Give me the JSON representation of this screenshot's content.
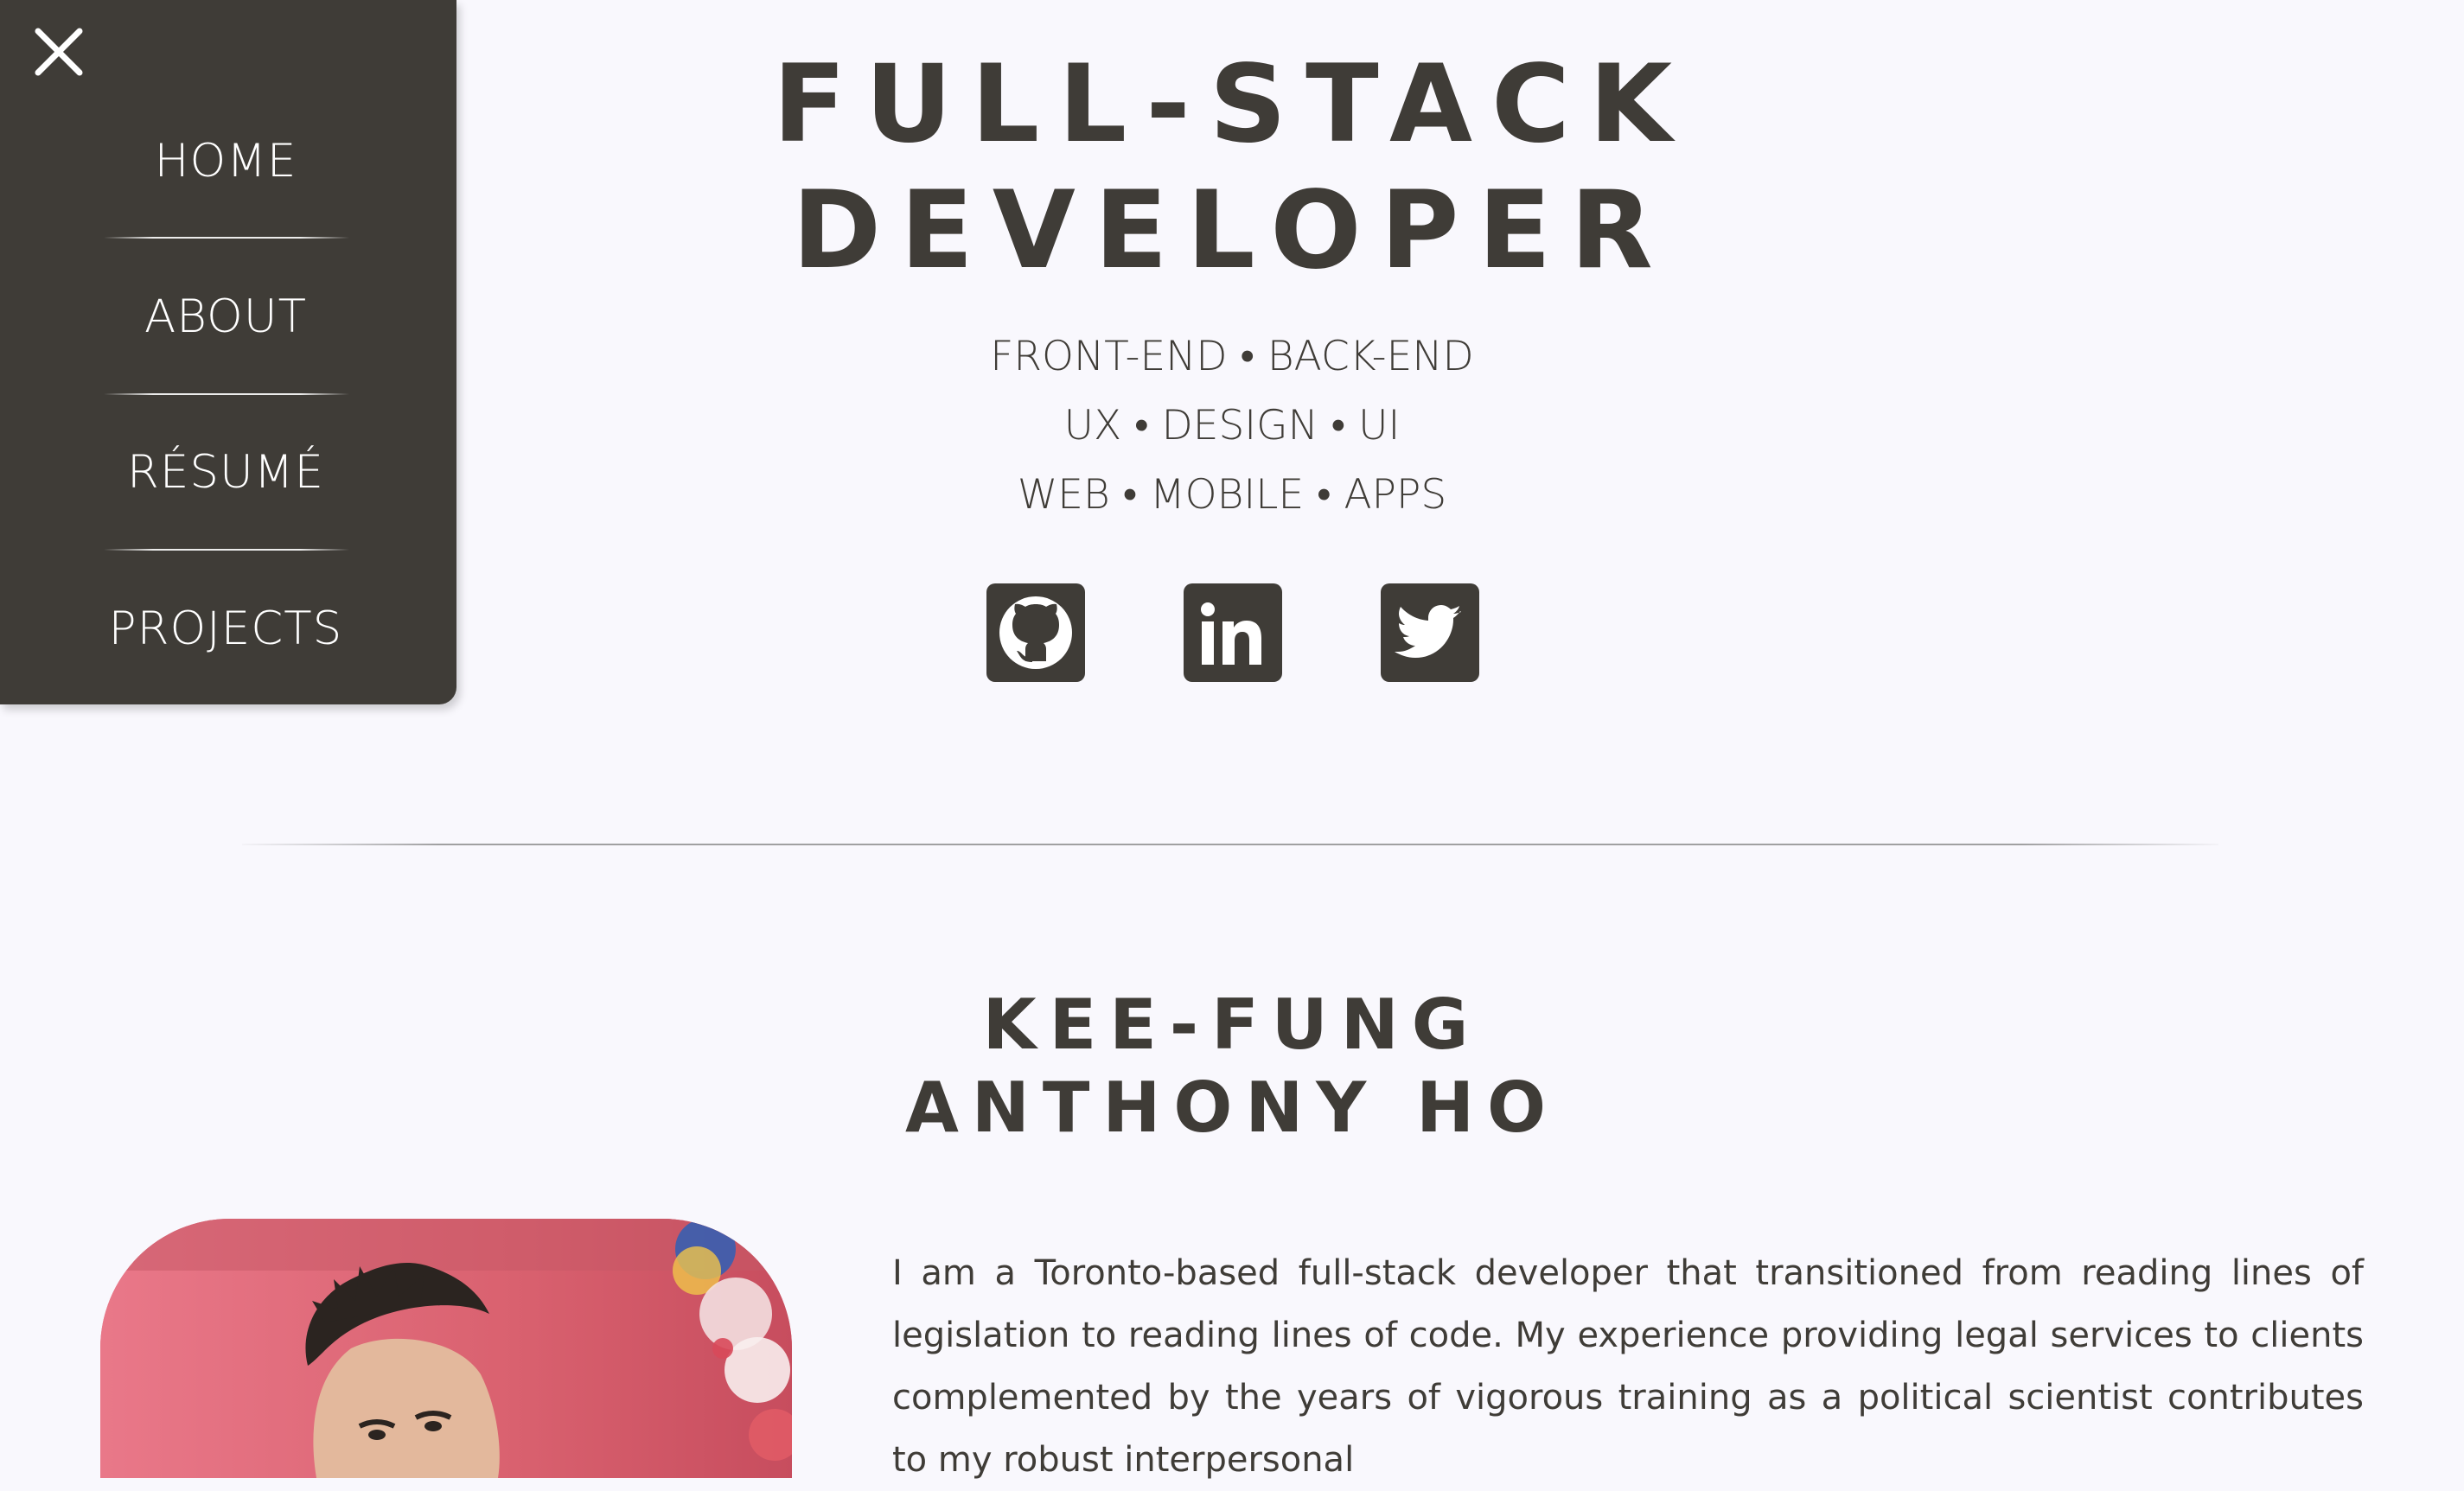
{
  "menu": {
    "close_icon": "close-icon",
    "items": [
      {
        "label": "HOME"
      },
      {
        "label": "ABOUT"
      },
      {
        "label": "RÉSUMÉ"
      },
      {
        "label": "PROJECTS"
      }
    ]
  },
  "hero": {
    "title_line1": "FULL-STACK",
    "title_line2": "DEVELOPER",
    "taglines": [
      "FRONT-END • BACK-END",
      "UX • DESIGN • UI",
      "WEB • MOBILE • APPS"
    ],
    "socials": [
      {
        "icon": "github-icon"
      },
      {
        "icon": "linkedin-icon"
      },
      {
        "icon": "twitter-icon"
      }
    ]
  },
  "about": {
    "name_line1": "KEE-FUNG",
    "name_line2": "ANTHONY HO",
    "bio": "I am a Toronto-based full-stack developer that transitioned from reading lines of legislation to reading lines of code. My experience providing legal services to clients complemented by the years of vigorous training as a political scientist contributes to my robust interpersonal"
  },
  "colors": {
    "background": "#f9f8fd",
    "menu_background": "#3f3c37",
    "text": "#3f3c37",
    "menu_text": "#ffffff",
    "portrait_background": "#de6f80"
  }
}
